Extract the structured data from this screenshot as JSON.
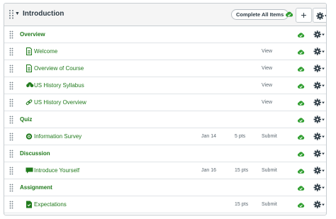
{
  "module": {
    "title": "Introduction",
    "complete_label": "Complete All Items",
    "add_label": "+",
    "publish_color": "#2f9e2f",
    "accent": "#207a1c"
  },
  "rows": [
    {
      "type": "header",
      "label": "Overview"
    },
    {
      "type": "item",
      "icon": "page-icon",
      "label": "Welcome",
      "date": "",
      "points": "",
      "requirement": "View"
    },
    {
      "type": "item",
      "icon": "page-icon",
      "label": "Overview of Course",
      "date": "",
      "points": "",
      "requirement": "View"
    },
    {
      "type": "item",
      "icon": "cloud-download-icon",
      "label": "US History Syllabus",
      "date": "",
      "points": "",
      "requirement": "View"
    },
    {
      "type": "item",
      "icon": "link-icon",
      "label": "US History Overview",
      "date": "",
      "points": "",
      "requirement": "View"
    },
    {
      "type": "header",
      "label": "Quiz"
    },
    {
      "type": "item",
      "icon": "survey-icon",
      "label": "Information Survey",
      "date": "Jan 14",
      "points": "5 pts",
      "requirement": "Submit"
    },
    {
      "type": "header",
      "label": "Discussion"
    },
    {
      "type": "item",
      "icon": "discussion-icon",
      "label": "Introduce Yourself",
      "date": "Jan 16",
      "points": "15 pts",
      "requirement": "Submit"
    },
    {
      "type": "header",
      "label": "Assignment"
    },
    {
      "type": "item",
      "icon": "assignment-icon",
      "label": "Expectations",
      "date": "",
      "points": "15 pts",
      "requirement": "Submit"
    }
  ]
}
